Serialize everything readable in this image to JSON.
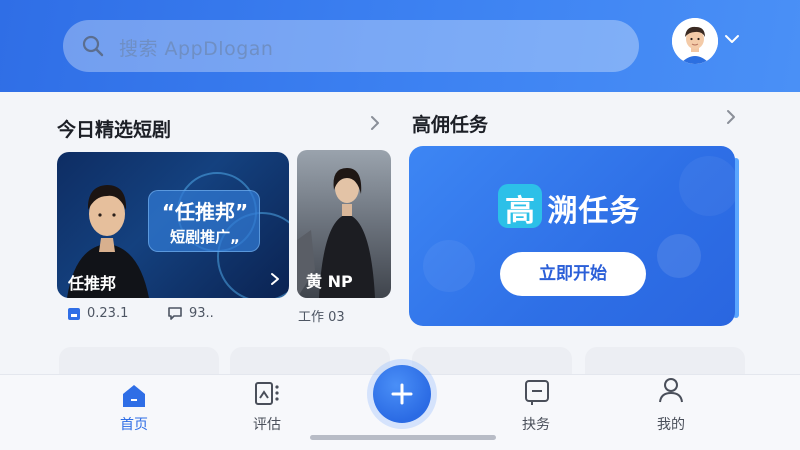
{
  "search": {
    "placeholder": "搜索 AppDlogan"
  },
  "section_drama": {
    "title": "今日精选短剧"
  },
  "section_task": {
    "title": "高佣任务"
  },
  "drama_main": {
    "bubble_title": "“任推邦”",
    "bubble_sub": "短剧推广„",
    "name": "任推邦",
    "stat_saves": "0.23.1",
    "stat_comments": "93.."
  },
  "drama_second": {
    "name": "黄 NP",
    "stat": "工作 03"
  },
  "task_card": {
    "title": "高 溯任务",
    "button": "立即开始"
  },
  "tabs": [
    {
      "label": "首页",
      "icon": "home-icon",
      "active": true
    },
    {
      "label": "评估",
      "icon": "review-icon",
      "active": false
    },
    {
      "label": "",
      "icon": "plus-icon",
      "active": false
    },
    {
      "label": "抉务",
      "icon": "task-icon",
      "active": false
    },
    {
      "label": "我的",
      "icon": "profile-icon",
      "active": false
    }
  ],
  "colors": {
    "primary": "#2f6ee6",
    "header_end": "#4a90f6",
    "task_card": "#3d86f4"
  }
}
